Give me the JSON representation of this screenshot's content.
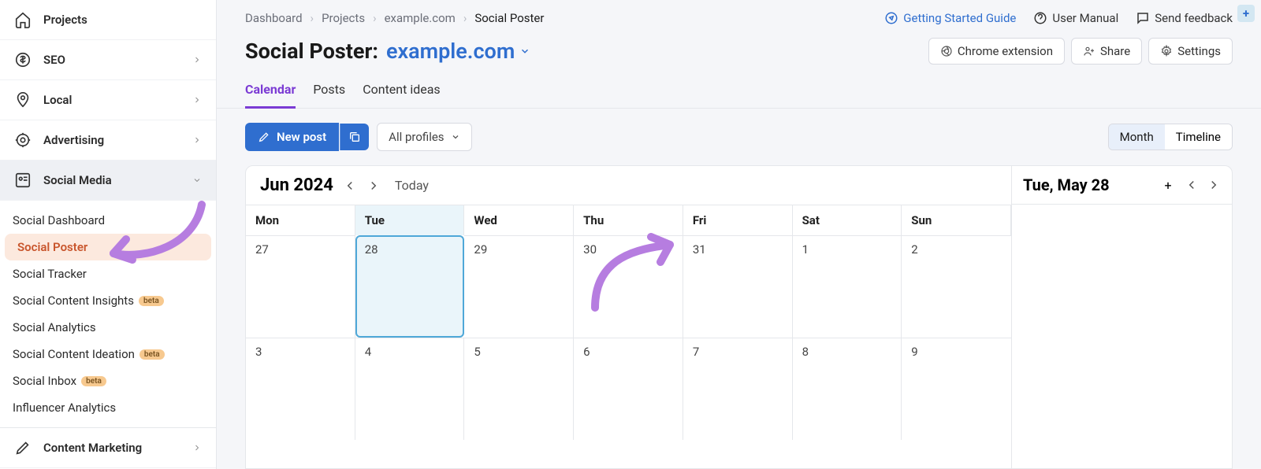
{
  "sidebar": {
    "projects": "Projects",
    "items": [
      {
        "label": "SEO"
      },
      {
        "label": "Local"
      },
      {
        "label": "Advertising"
      },
      {
        "label": "Social Media"
      },
      {
        "label": "Content Marketing"
      }
    ],
    "social_subs": [
      {
        "label": "Social Dashboard"
      },
      {
        "label": "Social Poster"
      },
      {
        "label": "Social Tracker"
      },
      {
        "label": "Social Content Insights",
        "badge": "beta"
      },
      {
        "label": "Social Analytics"
      },
      {
        "label": "Social Content Ideation",
        "badge": "beta"
      },
      {
        "label": "Social Inbox",
        "badge": "beta"
      },
      {
        "label": "Influencer Analytics"
      }
    ]
  },
  "breadcrumb": [
    "Dashboard",
    "Projects",
    "example.com",
    "Social Poster"
  ],
  "toplinks": {
    "guide": "Getting Started Guide",
    "manual": "User Manual",
    "feedback": "Send feedback"
  },
  "title": {
    "label": "Social Poster:",
    "domain": "example.com"
  },
  "title_buttons": {
    "chrome": "Chrome extension",
    "share": "Share",
    "settings": "Settings"
  },
  "tabs": [
    "Calendar",
    "Posts",
    "Content ideas"
  ],
  "toolbar": {
    "newpost": "New post",
    "profiles": "All profiles",
    "month": "Month",
    "timeline": "Timeline"
  },
  "calendar": {
    "month_label": "Jun 2024",
    "today": "Today",
    "days": [
      "Mon",
      "Tue",
      "Wed",
      "Thu",
      "Fri",
      "Sat",
      "Sun"
    ],
    "cells": [
      "27",
      "28",
      "29",
      "30",
      "31",
      "1",
      "2",
      "3",
      "4",
      "5",
      "6",
      "7",
      "8",
      "9"
    ]
  },
  "panel": {
    "date": "Tue, May 28"
  }
}
